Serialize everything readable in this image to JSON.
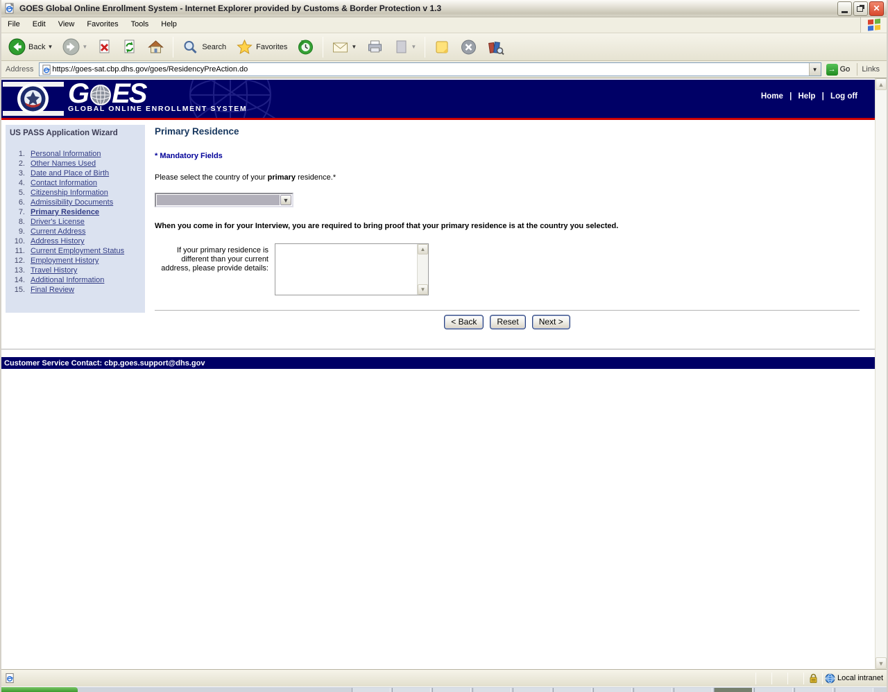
{
  "window": {
    "title": "GOES Global Online Enrollment System - Internet Explorer provided by Customs & Border Protection v 1.3"
  },
  "menu": {
    "items": [
      "File",
      "Edit",
      "View",
      "Favorites",
      "Tools",
      "Help"
    ]
  },
  "toolbar": {
    "back": "Back",
    "search": "Search",
    "favorites": "Favorites"
  },
  "address": {
    "label": "Address",
    "url": "https://goes-sat.cbp.dhs.gov/goes/ResidencyPreAction.do",
    "go": "Go",
    "links": "Links"
  },
  "site": {
    "logo_g": "G",
    "logo_es": "ES",
    "subtitle": "GLOBAL ONLINE ENROLLMENT SYSTEM",
    "nav": {
      "home": "Home",
      "sep1": "|",
      "help": "Help",
      "sep2": "|",
      "logoff": "Log off"
    }
  },
  "sidebar": {
    "title": "US PASS Application Wizard",
    "items": [
      {
        "num": "1.",
        "label": "Personal Information"
      },
      {
        "num": "2.",
        "label": "Other Names Used"
      },
      {
        "num": "3.",
        "label": "Date and Place of Birth"
      },
      {
        "num": "4.",
        "label": "Contact Information"
      },
      {
        "num": "5.",
        "label": "Citizenship Information"
      },
      {
        "num": "6.",
        "label": "Admissibility Documents"
      },
      {
        "num": "7.",
        "label": "Primary Residence"
      },
      {
        "num": "8.",
        "label": "Driver's License"
      },
      {
        "num": "9.",
        "label": "Current Address"
      },
      {
        "num": "10.",
        "label": "Address History"
      },
      {
        "num": "11.",
        "label": "Current Employment Status"
      },
      {
        "num": "12.",
        "label": "Employment History"
      },
      {
        "num": "13.",
        "label": "Travel History"
      },
      {
        "num": "14.",
        "label": "Additional Information"
      },
      {
        "num": "15.",
        "label": "Final Review"
      }
    ]
  },
  "main": {
    "title": "Primary Residence",
    "mandatory": "* Mandatory Fields",
    "prompt_prefix": "Please select the country of your ",
    "prompt_bold": "primary",
    "prompt_suffix": " residence.*",
    "country_select_value": "",
    "interview_note": "When you come in for your Interview, you are required to bring proof that your primary residence is at the country you selected.",
    "details_label": "If your primary residence is different than your current address, please provide details:",
    "details_value": "",
    "buttons": {
      "back": "< Back",
      "reset": "Reset",
      "next": "Next >"
    }
  },
  "footer": {
    "text": "Customer Service Contact: cbp.goes.support@dhs.gov"
  },
  "status": {
    "zone": "Local intranet"
  },
  "colors": {
    "navy": "#000066",
    "red_line": "#cc0000",
    "sidebar_bg": "#dbe2f0",
    "link": "#323c85"
  }
}
